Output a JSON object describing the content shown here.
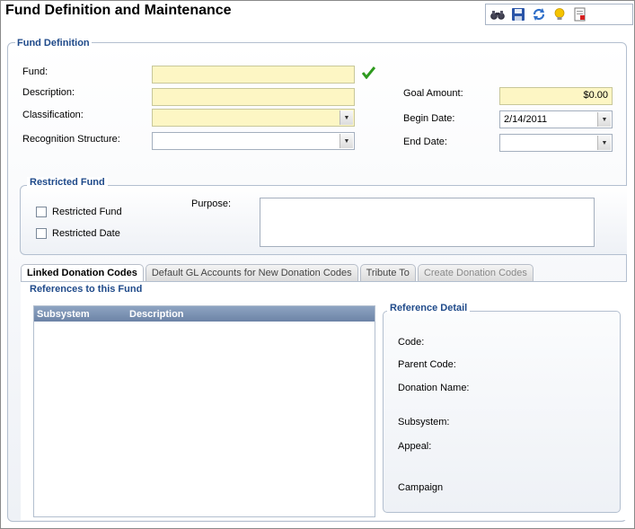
{
  "window": {
    "title": "Fund Definition and Maintenance"
  },
  "toolbar": {
    "icons": [
      "binoculars-icon",
      "save-icon",
      "refresh-icon",
      "lightbulb-icon",
      "report-icon"
    ]
  },
  "fund_definition": {
    "legend": "Fund Definition",
    "fund_label": "Fund:",
    "fund_value": "",
    "description_label": "Description:",
    "description_value": "",
    "classification_label": "Classification:",
    "classification_value": "",
    "recognition_label": "Recognition Structure:",
    "recognition_value": "",
    "goal_amount_label": "Goal Amount:",
    "goal_amount_value": "$0.00",
    "begin_date_label": "Begin Date:",
    "begin_date_value": "2/14/2011",
    "end_date_label": "End Date:",
    "end_date_value": ""
  },
  "restricted_fund": {
    "legend": "Restricted Fund",
    "restricted_fund_label": "Restricted Fund",
    "restricted_fund_checked": false,
    "restricted_date_label": "Restricted Date",
    "restricted_date_checked": false,
    "purpose_label": "Purpose:",
    "purpose_value": ""
  },
  "tabs": [
    {
      "label": "Linked Donation Codes",
      "state": "active"
    },
    {
      "label": "Default GL Accounts for New Donation Codes",
      "state": "normal"
    },
    {
      "label": "Tribute To",
      "state": "normal"
    },
    {
      "label": "Create Donation Codes",
      "state": "disabled"
    }
  ],
  "references": {
    "legend": "References to this Fund",
    "columns": [
      "Subsystem",
      "Description"
    ],
    "rows": []
  },
  "reference_detail": {
    "legend": "Reference Detail",
    "code_label": "Code:",
    "parent_code_label": "Parent Code:",
    "donation_name_label": "Donation Name:",
    "subsystem_label": "Subsystem:",
    "appeal_label": "Appeal:",
    "campaign_label": "Campaign"
  },
  "colors": {
    "legend_text": "#1f4a8a",
    "required_field": "#fdf6c4",
    "grid_header": "#7a90b1",
    "valid_check": "#2e9a1e"
  }
}
